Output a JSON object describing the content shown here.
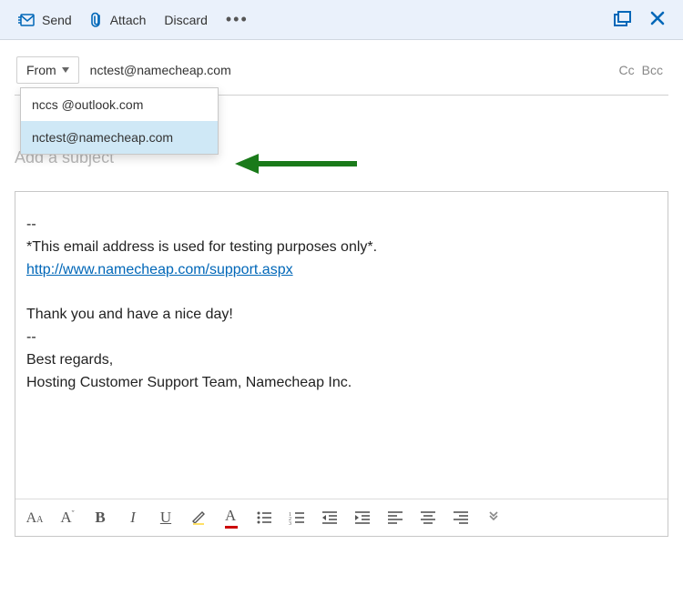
{
  "toolbar": {
    "send_label": "Send",
    "attach_label": "Attach",
    "discard_label": "Discard",
    "more_label": "•••"
  },
  "from": {
    "label": "From",
    "selected_email": "nctest@namecheap.com",
    "options": [
      {
        "email": "nccs @outlook.com"
      },
      {
        "email": "nctest@namecheap.com"
      }
    ]
  },
  "cc_label": "Cc",
  "bcc_label": "Bcc",
  "subject": {
    "placeholder": "Add a subject",
    "value": ""
  },
  "body": {
    "sep1": "--",
    "line1": "*This email address is used for testing purposes only*.",
    "link_text": "http://www.namecheap.com/support.aspx",
    "line2": "Thank you and have a nice day!",
    "sep2": "--",
    "line3": "Best regards,",
    "line4": "Hosting Customer Support Team, Namecheap Inc."
  },
  "colors": {
    "accent": "#0067b8",
    "toolbar_bg": "#eaf1fb",
    "highlight": "#cfe8f6",
    "arrow_green": "#1a7a1a"
  }
}
